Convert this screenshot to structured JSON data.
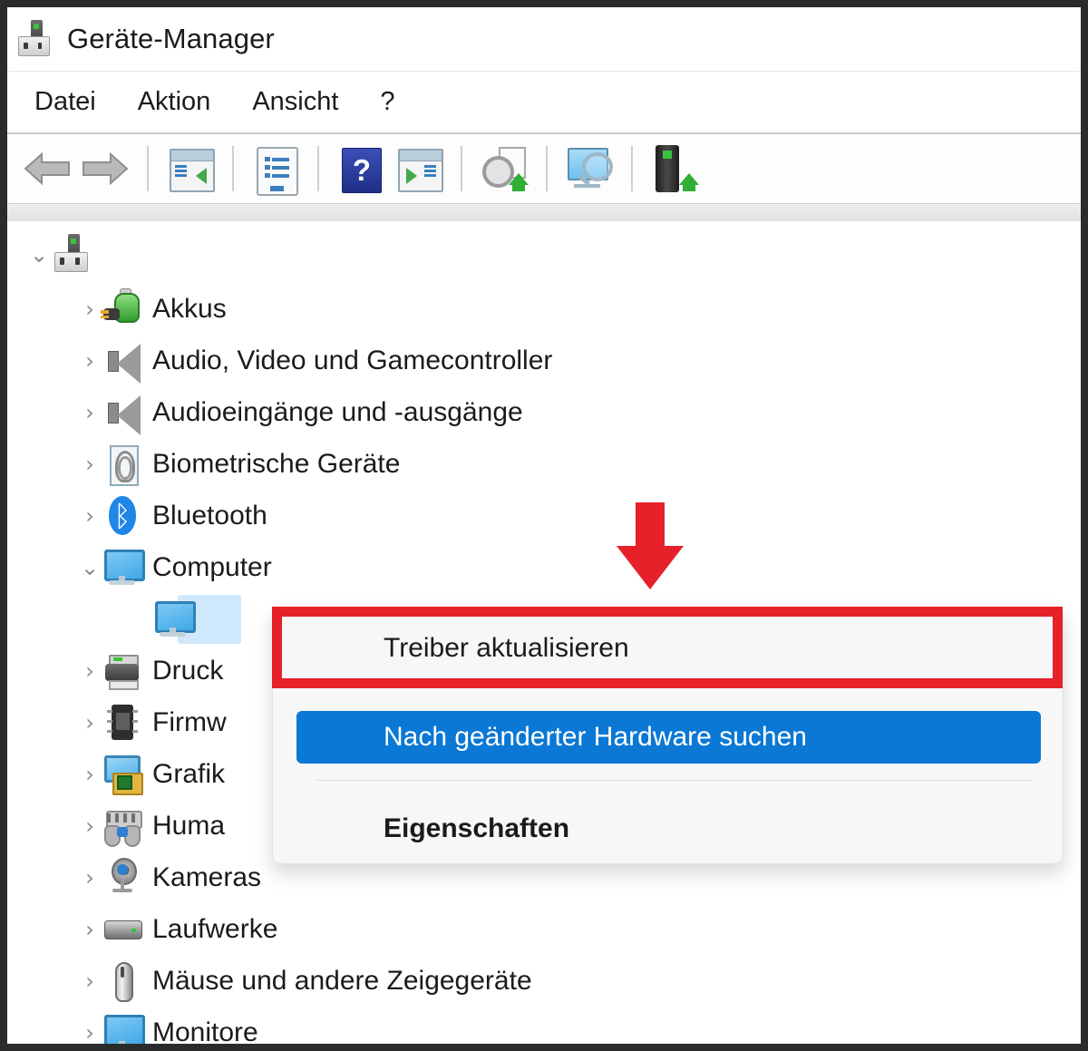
{
  "window": {
    "title": "Geräte-Manager",
    "icon": "device-manager-icon"
  },
  "menubar": {
    "items": [
      {
        "label": "Datei",
        "name": "menu-datei"
      },
      {
        "label": "Aktion",
        "name": "menu-aktion"
      },
      {
        "label": "Ansicht",
        "name": "menu-ansicht"
      },
      {
        "label": "?",
        "name": "menu-help"
      }
    ]
  },
  "toolbar": {
    "buttons": [
      {
        "name": "back-icon",
        "kind": "arrow-left"
      },
      {
        "name": "forward-icon",
        "kind": "arrow-right"
      },
      {
        "name": "show-hide-console-tree-icon",
        "kind": "window-tree"
      },
      {
        "name": "properties-icon",
        "kind": "document"
      },
      {
        "name": "help-icon",
        "kind": "help"
      },
      {
        "name": "show-hide-action-pane-icon",
        "kind": "window-pane"
      },
      {
        "name": "update-driver-icon",
        "kind": "gear-update"
      },
      {
        "name": "scan-for-hardware-changes-icon",
        "kind": "monitor-scan"
      },
      {
        "name": "add-legacy-hardware-icon",
        "kind": "device-add"
      }
    ]
  },
  "tree": {
    "root": {
      "label": "",
      "expanded": true,
      "icon": "computer-root-icon"
    },
    "items": [
      {
        "label": "Akkus",
        "icon": "battery-icon",
        "expanded": false,
        "indent": 1
      },
      {
        "label": "Audio, Video und Gamecontroller",
        "icon": "speaker-icon",
        "expanded": false,
        "indent": 1
      },
      {
        "label": "Audioeingänge und -ausgänge",
        "icon": "speaker-icon",
        "expanded": false,
        "indent": 1
      },
      {
        "label": "Biometrische Geräte",
        "icon": "fingerprint-icon",
        "expanded": false,
        "indent": 1
      },
      {
        "label": "Bluetooth",
        "icon": "bluetooth-icon",
        "expanded": false,
        "indent": 1
      },
      {
        "label": "Computer",
        "icon": "monitor-icon",
        "expanded": true,
        "indent": 1
      },
      {
        "label": "",
        "icon": "monitor-icon",
        "expanded": null,
        "indent": 2,
        "selected": true
      },
      {
        "label": "Druck",
        "icon": "printer-icon",
        "expanded": false,
        "indent": 1
      },
      {
        "label": "Firmw",
        "icon": "firmware-chip-icon",
        "expanded": false,
        "indent": 1
      },
      {
        "label": "Grafik",
        "icon": "graphics-card-icon",
        "expanded": false,
        "indent": 1
      },
      {
        "label": "Huma",
        "icon": "hid-gamepad-icon",
        "expanded": false,
        "indent": 1
      },
      {
        "label": "Kameras",
        "icon": "camera-icon",
        "expanded": false,
        "indent": 1
      },
      {
        "label": "Laufwerke",
        "icon": "disk-drive-icon",
        "expanded": false,
        "indent": 1
      },
      {
        "label": "Mäuse und andere Zeigegeräte",
        "icon": "mouse-icon",
        "expanded": false,
        "indent": 1
      },
      {
        "label": "Monitore",
        "icon": "monitor-icon",
        "expanded": false,
        "indent": 1
      }
    ],
    "chevron_collapsed": "›",
    "chevron_expanded": "⌄"
  },
  "context_menu": {
    "items": [
      {
        "label": "Treiber aktualisieren",
        "highlighted": false,
        "bold": false,
        "name": "ctx-update-driver"
      },
      {
        "label": "Nach geänderter Hardware suchen",
        "highlighted": true,
        "bold": false,
        "name": "ctx-scan-hardware-changes"
      },
      {
        "label": "Eigenschaften",
        "highlighted": false,
        "bold": true,
        "name": "ctx-properties"
      }
    ]
  },
  "annotations": {
    "arrow": {
      "name": "red-down-arrow",
      "color": "#e6212a"
    },
    "highlight_box": {
      "name": "red-highlight-box",
      "color": "#e6212a",
      "targets": "Treiber aktualisieren"
    }
  },
  "colors": {
    "accent_blue": "#0a78d4",
    "annotation_red": "#e6212a",
    "selection_blue": "#cfe8fb",
    "menu_bg": "#f7f7f7"
  }
}
